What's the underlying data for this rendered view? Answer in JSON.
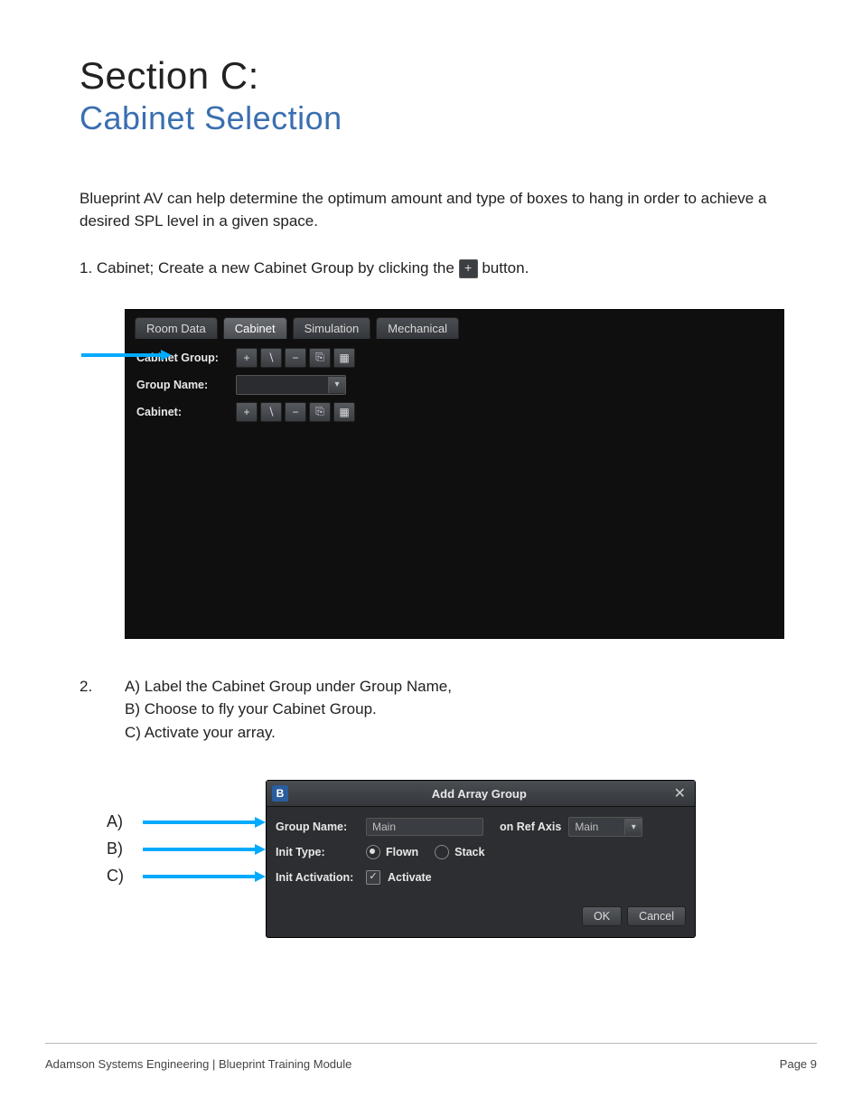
{
  "header": {
    "section_label": "Section C:",
    "subtitle": "Cabinet Selection"
  },
  "intro": "Blueprint AV can help determine the optimum amount and type of boxes to hang in order to achieve a desired SPL level in a given space.",
  "step1": {
    "text_before": "1. Cabinet; Create a new Cabinet Group by clicking the ",
    "plus_glyph": "+",
    "text_after": " button."
  },
  "screenshot1": {
    "tabs": [
      "Room Data",
      "Cabinet",
      "Simulation",
      "Mechanical"
    ],
    "active_tab_index": 1,
    "rows": [
      {
        "label": "Cabinet Group:",
        "type": "icons"
      },
      {
        "label": "Group Name:",
        "type": "dropdown"
      },
      {
        "label": "Cabinet:",
        "type": "icons"
      }
    ],
    "icon_names": [
      "plus-icon",
      "edit-icon",
      "minus-icon",
      "copy-icon",
      "folder-icon"
    ],
    "icon_glyphs": [
      "+",
      "∖",
      "−",
      "⎘",
      "▦"
    ]
  },
  "step2": {
    "number": "2.",
    "lines": [
      "A) Label the Cabinet Group under Group Name,",
      "B) Choose to fly your Cabinet Group.",
      "C) Activate your array."
    ]
  },
  "abc_markers": [
    "A)",
    "B)",
    "C)"
  ],
  "dialog": {
    "logo_letter": "B",
    "title": "Add Array Group",
    "group_name_label": "Group Name:",
    "group_name_value": "Main",
    "on_ref_axis_label": "on Ref Axis",
    "on_ref_axis_value": "Main",
    "init_type_label": "Init Type:",
    "flown_label": "Flown",
    "stack_label": "Stack",
    "init_type_selected": "Flown",
    "init_activation_label": "Init Activation:",
    "activate_label": "Activate",
    "activate_checked": true,
    "ok_label": "OK",
    "cancel_label": "Cancel"
  },
  "footer": {
    "left": "Adamson Systems Engineering  |  Blueprint Training Module",
    "right": "Page 9"
  }
}
